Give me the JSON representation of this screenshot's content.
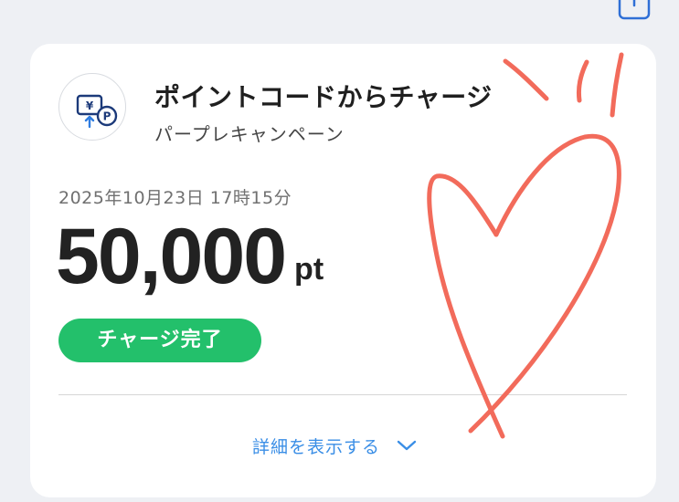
{
  "header": {
    "share_icon": "share-icon"
  },
  "card": {
    "logo_icon": "point-code-charge-icon",
    "title": "ポイントコードからチャージ",
    "subtitle": "パープレキャンペーン",
    "datetime": "2025年10月23日 17時15分",
    "amount": "50,000",
    "unit": "pt",
    "status": "チャージ完了",
    "details_label": "詳細を表示する",
    "details_icon": "chevron-down-icon"
  },
  "annotation": {
    "type": "hand-drawn-heart",
    "color": "#f26b5b"
  },
  "colors": {
    "background": "#eef0f4",
    "card": "#ffffff",
    "status_green": "#23c06b",
    "link_blue": "#3a8ee6",
    "logo_navy": "#1c3a7a",
    "logo_blue": "#2f7de1",
    "annotation": "#f26b5b"
  }
}
